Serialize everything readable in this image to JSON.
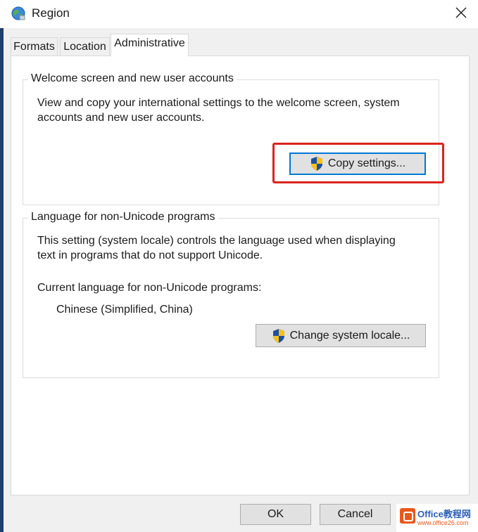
{
  "window": {
    "title": "Region",
    "close_glyph": "✕"
  },
  "tabs": [
    {
      "label": "Formats",
      "active": false
    },
    {
      "label": "Location",
      "active": false
    },
    {
      "label": "Administrative",
      "active": true
    }
  ],
  "welcome_group": {
    "title": "Welcome screen and new user accounts",
    "description_line1": "View and copy your international settings to the welcome screen, system",
    "description_line2": "accounts and new user accounts.",
    "copy_button": "Copy settings..."
  },
  "nonunicode_group": {
    "title": "Language for non-Unicode programs",
    "description_line1": "This setting (system locale) controls the language used when displaying",
    "description_line2": "text in programs that do not support Unicode.",
    "current_label": "Current language for non-Unicode programs:",
    "current_value": "Chinese (Simplified, China)",
    "change_button": "Change system locale..."
  },
  "footer": {
    "ok": "OK",
    "cancel": "Cancel"
  },
  "watermark": {
    "line1": "Office教程网",
    "line2": "www.office26.com"
  },
  "colors": {
    "highlight_border": "#d9241f",
    "focus_border": "#0078d7",
    "shield_blue": "#1e4fa3",
    "shield_yellow": "#f3c21b"
  },
  "icons": [
    "globe-icon",
    "close-icon",
    "uac-shield-icon"
  ]
}
